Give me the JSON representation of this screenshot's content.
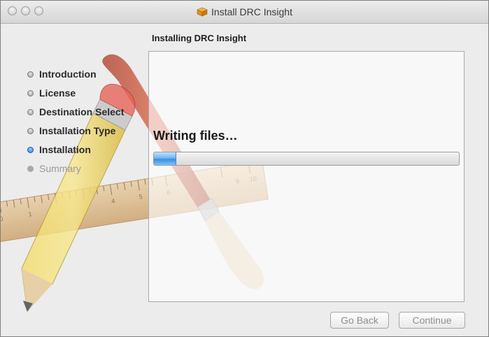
{
  "window": {
    "title": "Install DRC Insight"
  },
  "header": {
    "title": "Installing DRC Insight"
  },
  "sidebar": {
    "steps": [
      {
        "label": "Introduction",
        "state": "completed"
      },
      {
        "label": "License",
        "state": "completed"
      },
      {
        "label": "Destination Select",
        "state": "completed"
      },
      {
        "label": "Installation Type",
        "state": "completed"
      },
      {
        "label": "Installation",
        "state": "current"
      },
      {
        "label": "Summary",
        "state": "pending"
      }
    ]
  },
  "main": {
    "status": "Writing files…",
    "progress_fraction": 0.07
  },
  "buttons": {
    "back": "Go Back",
    "continue": "Continue"
  },
  "icons": {
    "title_icon": "package-icon",
    "background_art": "pencil-ruler-brush-illustration"
  },
  "colors": {
    "progress_accent": "#3b8fe0",
    "current_step_bullet": "#2477d9"
  }
}
